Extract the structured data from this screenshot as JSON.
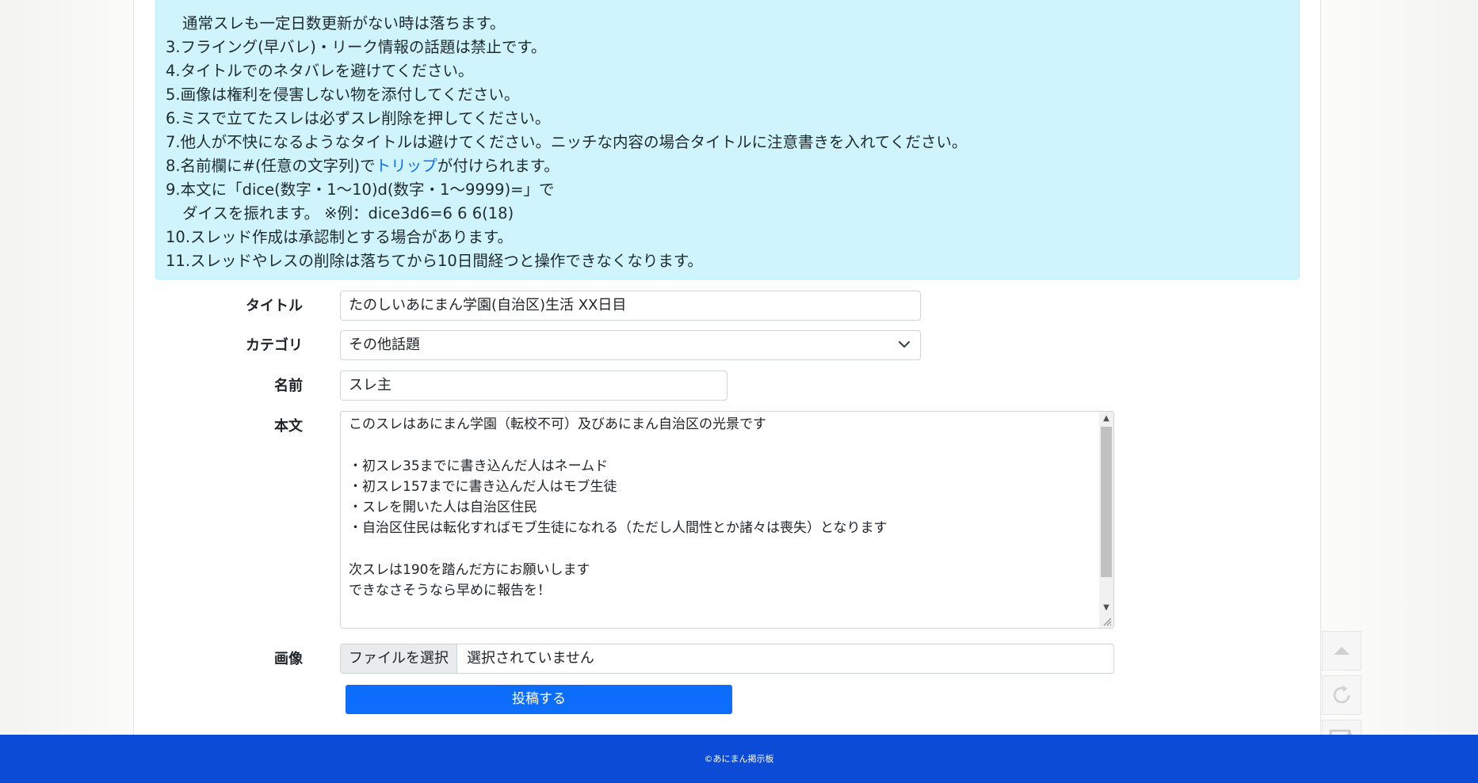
{
  "rules": {
    "lines": [
      {
        "text": "通常スレも一定日数更新がない時は落ちます。",
        "indent": true
      },
      {
        "text": "3.フライング(早バレ)・リーク情報の話題は禁止です。",
        "indent": false
      },
      {
        "text": "4.タイトルでのネタバレを避けてください。",
        "indent": false
      },
      {
        "text": "5.画像は権利を侵害しない物を添付してください。",
        "indent": false
      },
      {
        "text": "6.ミスで立てたスレは必ずスレ削除を押してください。",
        "indent": false
      },
      {
        "text": "7.他人が不快になるようなタイトルは避けてください。ニッチな内容の場合タイトルに注意書きを入れてください。",
        "indent": false
      }
    ],
    "trip_prefix": "8.名前欄に#(任意の文字列)で",
    "trip_link": "トリップ",
    "trip_suffix": "が付けられます。",
    "dice_line1": "9.本文に「dice(数字・1～10)d(数字・1～9999)=」で",
    "dice_line2": "ダイスを振れます。 ※例：dice3d6=6 6 6(18)",
    "rule10": "10.スレッド作成は承認制とする場合があります。",
    "rule11": "11.スレッドやレスの削除は落ちてから10日間経つと操作できなくなります。"
  },
  "form": {
    "title_label": "タイトル",
    "title_value": "たのしいあにまん学園(自治区)生活 XX日目",
    "category_label": "カテゴリ",
    "category_value": "その他話題",
    "name_label": "名前",
    "name_value": "スレ主",
    "body_label": "本文",
    "body_lines": [
      "このスレはあにまん学園（転校不可）及びあにまん自治区の光景です",
      "",
      "・初スレ35までに書き込んだ人はネームド",
      "・初スレ157までに書き込んだ人はモブ生徒",
      "・スレを開いた人は自治区住民",
      "・自治区住民は転化すればモブ生徒になれる（ただし人間性とか諸々は喪失）となります",
      "",
      "次スレは190を踏んだ方にお願いします",
      "できなさそうなら早めに報告を！"
    ],
    "image_label": "画像",
    "file_button": "ファイルを選択",
    "file_status": "選択されていません",
    "submit_label": "投稿する"
  },
  "footer": {
    "copyright": "©あにまん掲示板"
  },
  "side_buttons": {
    "icons": [
      "scroll-top-icon",
      "reload-icon",
      "write-icon"
    ]
  }
}
